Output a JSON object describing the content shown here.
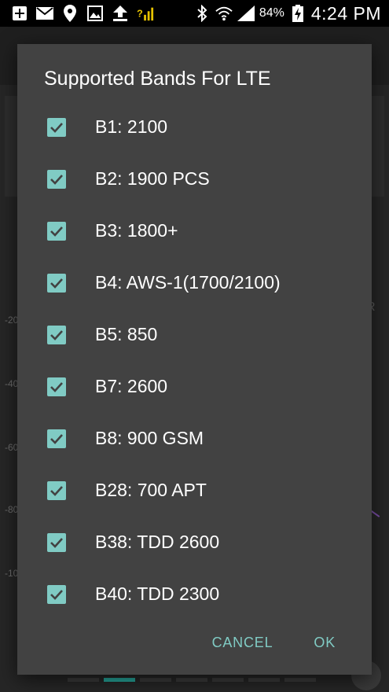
{
  "status_bar": {
    "battery_text": "84%",
    "time": "4:24 PM"
  },
  "background": {
    "axis_labels": [
      "-20",
      "-40",
      "-60",
      "-80",
      "-10"
    ],
    "side_letter": "R"
  },
  "dialog": {
    "title": "Supported Bands For LTE",
    "bands": [
      {
        "label": "B1: 2100",
        "checked": true
      },
      {
        "label": "B2: 1900 PCS",
        "checked": true
      },
      {
        "label": "B3: 1800+",
        "checked": true
      },
      {
        "label": "B4: AWS-1(1700/2100)",
        "checked": true
      },
      {
        "label": "B5: 850",
        "checked": true
      },
      {
        "label": "B7: 2600",
        "checked": true
      },
      {
        "label": "B8: 900 GSM",
        "checked": true
      },
      {
        "label": "B28: 700 APT",
        "checked": true
      },
      {
        "label": "B38: TDD 2600",
        "checked": true
      },
      {
        "label": "B40: TDD 2300",
        "checked": true
      }
    ],
    "cancel_label": "CANCEL",
    "ok_label": "OK"
  },
  "colors": {
    "accent": "#80cbc4",
    "dialog_bg": "#424242"
  }
}
